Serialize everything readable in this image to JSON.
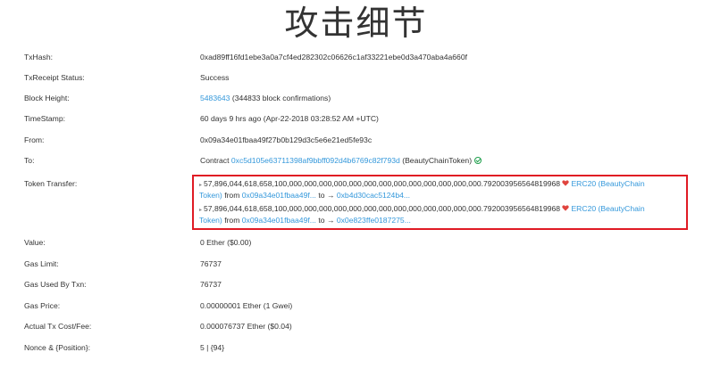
{
  "header": {
    "title": "攻击细节"
  },
  "details": {
    "txhash": {
      "label": "TxHash:",
      "value": "0xad89ff16fd1ebe3a0a7cf4ed282302c06626c1af33221ebe0d3a470aba4a660f"
    },
    "status": {
      "label": "TxReceipt Status:",
      "value": "Success"
    },
    "block": {
      "label": "Block Height:",
      "number": "5483643",
      "confirmations": "(344833 block confirmations)"
    },
    "timestamp": {
      "label": "TimeStamp:",
      "value": "60 days 9 hrs ago (Apr-22-2018 03:28:52 AM +UTC)"
    },
    "from": {
      "label": "From:",
      "value": "0x09a34e01fbaa49f27b0b129d3c5e6e21ed5fe93c"
    },
    "to": {
      "label": "To:",
      "prefix": "Contract",
      "address": "0xc5d105e63711398af9bbff092d4b6769c82f793d",
      "name": "(BeautyChainToken)"
    },
    "token_transfer": {
      "label": "Token Transfer:",
      "items": [
        {
          "amount": "57,896,044,618,658,100,000,000,000,000,000,000,000,000,000,000,000,000,000.792003956564819968",
          "token_a": "ERC20 (BeautyChain",
          "token_b": "Token)",
          "from_word": "from",
          "from": "0x09a34e01fbaa49f...",
          "to_word": "to →",
          "to": "0xb4d30cac5124b4..."
        },
        {
          "amount": "57,896,044,618,658,100,000,000,000,000,000,000,000,000,000,000,000,000,000.792003956564819968",
          "token_a": "ERC20 (BeautyChain",
          "token_b": "Token)",
          "from_word": "from",
          "from": "0x09a34e01fbaa49f...",
          "to_word": "to →",
          "to": "0x0e823ffe0187275..."
        }
      ]
    },
    "value": {
      "label": "Value:",
      "value": "0 Ether ($0.00)"
    },
    "gas_limit": {
      "label": "Gas Limit:",
      "value": "76737"
    },
    "gas_used": {
      "label": "Gas Used By Txn:",
      "value": "76737"
    },
    "gas_price": {
      "label": "Gas Price:",
      "value": "0.00000001 Ether (1 Gwei)"
    },
    "tx_fee": {
      "label": "Actual Tx Cost/Fee:",
      "value": "0.000076737 Ether ($0.04)"
    },
    "nonce": {
      "label": "Nonce & {Position}:",
      "value": "5 | {94}"
    }
  },
  "colors": {
    "link": "#3498db",
    "success": "#1e9e4b",
    "highlight_border": "#e01b24"
  },
  "icons": {
    "status_check": "check-circle-icon",
    "token_heart": "heart-icon"
  }
}
